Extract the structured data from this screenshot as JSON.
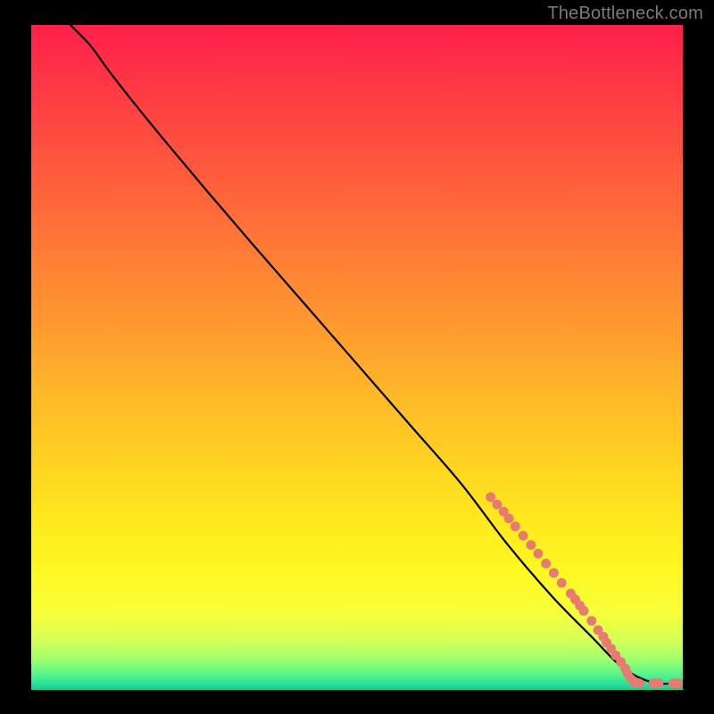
{
  "watermark": "TheBottleneck.com",
  "colors": {
    "background": "#000000",
    "dot": "#e77b72",
    "curve": "#000000",
    "gradient_stops": [
      {
        "offset": 0.0,
        "color": "#ff1f4b"
      },
      {
        "offset": 0.1,
        "color": "#ff3a44"
      },
      {
        "offset": 0.22,
        "color": "#ff5a3d"
      },
      {
        "offset": 0.34,
        "color": "#ff7b36"
      },
      {
        "offset": 0.46,
        "color": "#ff9b2f"
      },
      {
        "offset": 0.56,
        "color": "#ffb928"
      },
      {
        "offset": 0.66,
        "color": "#ffd321"
      },
      {
        "offset": 0.74,
        "color": "#ffe81e"
      },
      {
        "offset": 0.82,
        "color": "#fff722"
      },
      {
        "offset": 0.885,
        "color": "#f8ff3a"
      },
      {
        "offset": 0.925,
        "color": "#d4ff56"
      },
      {
        "offset": 0.955,
        "color": "#9cff70"
      },
      {
        "offset": 0.975,
        "color": "#5cf78a"
      },
      {
        "offset": 0.99,
        "color": "#2de29a"
      },
      {
        "offset": 1.0,
        "color": "#18c98f"
      }
    ]
  },
  "chart_data": {
    "type": "line",
    "xlabel": "",
    "ylabel": "",
    "xlim": [
      0,
      100
    ],
    "ylim": [
      0,
      100
    ],
    "title": "",
    "series": [
      {
        "name": "curve",
        "x": [
          6,
          9,
          12,
          16,
          21,
          27,
          34,
          42,
          50,
          58,
          66,
          73,
          80,
          86,
          90,
          93,
          96,
          99
        ],
        "y": [
          100,
          97,
          93,
          88,
          82,
          75,
          67,
          58,
          49,
          40,
          31,
          22,
          14,
          8,
          4,
          2,
          1,
          1
        ]
      }
    ],
    "markers": [
      {
        "x": 70.5,
        "y": 29.0
      },
      {
        "x": 71.5,
        "y": 27.9
      },
      {
        "x": 72.5,
        "y": 26.8
      },
      {
        "x": 73.3,
        "y": 25.8
      },
      {
        "x": 74.3,
        "y": 24.6
      },
      {
        "x": 75.5,
        "y": 23.2
      },
      {
        "x": 76.7,
        "y": 21.8
      },
      {
        "x": 77.8,
        "y": 20.5
      },
      {
        "x": 79.0,
        "y": 19.0
      },
      {
        "x": 80.2,
        "y": 17.6
      },
      {
        "x": 81.4,
        "y": 16.1
      },
      {
        "x": 82.8,
        "y": 14.5
      },
      {
        "x": 83.5,
        "y": 13.6
      },
      {
        "x": 84.2,
        "y": 12.7
      },
      {
        "x": 84.8,
        "y": 11.9
      },
      {
        "x": 86.0,
        "y": 10.4
      },
      {
        "x": 87.0,
        "y": 9.0
      },
      {
        "x": 87.8,
        "y": 8.0
      },
      {
        "x": 88.3,
        "y": 7.1
      },
      {
        "x": 89.0,
        "y": 6.2
      },
      {
        "x": 89.7,
        "y": 5.2
      },
      {
        "x": 90.5,
        "y": 4.2
      },
      {
        "x": 91.2,
        "y": 3.2
      },
      {
        "x": 91.5,
        "y": 2.5
      },
      {
        "x": 92.0,
        "y": 1.7
      },
      {
        "x": 92.5,
        "y": 1.2
      },
      {
        "x": 93.3,
        "y": 1.0
      },
      {
        "x": 95.5,
        "y": 1.0
      },
      {
        "x": 96.3,
        "y": 1.0
      },
      {
        "x": 98.5,
        "y": 1.0
      },
      {
        "x": 99.3,
        "y": 1.0
      }
    ]
  }
}
